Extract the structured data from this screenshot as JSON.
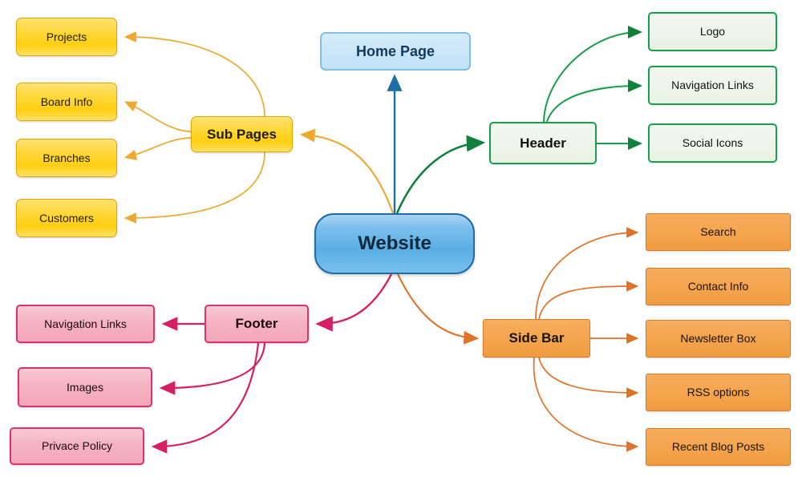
{
  "diagram": {
    "title": "Website",
    "type": "mind-map",
    "background_color": "#ffffff"
  },
  "center": {
    "label": "Website",
    "color": "#5aaee4",
    "border_color": "#1c6ca8"
  },
  "branches": [
    {
      "id": "home-page",
      "label": "Home Page",
      "color": "#c2e2f7",
      "border_color": "#7fc0e8",
      "connector_color": "#1b6ea8",
      "children": []
    },
    {
      "id": "sub-pages",
      "label": "Sub Pages",
      "color": "#ffd633",
      "border_color": "#e0a800",
      "connector_color": "#e0a23c",
      "children": [
        {
          "id": "projects",
          "label": "Projects"
        },
        {
          "id": "board-info",
          "label": "Board Info"
        },
        {
          "id": "branches",
          "label": "Branches"
        },
        {
          "id": "customers",
          "label": "Customers"
        }
      ]
    },
    {
      "id": "header",
      "label": "Header",
      "color": "#eef4ea",
      "border_color": "#17a04a",
      "connector_color": "#10803c",
      "children": [
        {
          "id": "logo",
          "label": "Logo"
        },
        {
          "id": "navigation-links",
          "label": "Navigation Links"
        },
        {
          "id": "social-icons",
          "label": "Social Icons"
        }
      ]
    },
    {
      "id": "side-bar",
      "label": "Side Bar",
      "color": "#f4a44d",
      "border_color": "#d9792c",
      "connector_color": "#d9762a",
      "children": [
        {
          "id": "search",
          "label": "Search"
        },
        {
          "id": "contact-info",
          "label": "Contact Info"
        },
        {
          "id": "newsletter-box",
          "label": "Newsletter Box"
        },
        {
          "id": "rss-options",
          "label": "RSS options"
        },
        {
          "id": "recent-blog-posts",
          "label": "Recent Blog Posts"
        }
      ]
    },
    {
      "id": "footer",
      "label": "Footer",
      "color": "#f5b3c2",
      "border_color": "#d6356f",
      "connector_color": "#d61f65",
      "children": [
        {
          "id": "footer-navigation-links",
          "label": "Navigation Links"
        },
        {
          "id": "images",
          "label": "Images"
        },
        {
          "id": "privace-policy",
          "label": "Privace Policy"
        }
      ]
    }
  ]
}
